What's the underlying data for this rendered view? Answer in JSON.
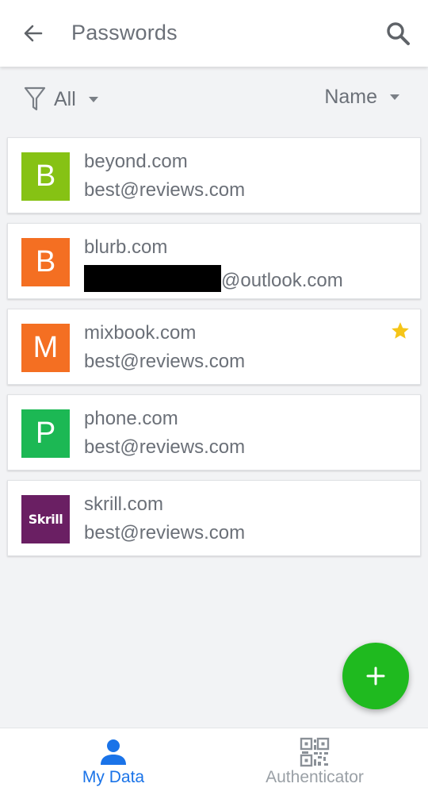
{
  "header": {
    "title": "Passwords"
  },
  "filter": {
    "label": "All"
  },
  "sort": {
    "label": "Name"
  },
  "entries": [
    {
      "initial": "B",
      "site": "beyond.com",
      "username": "best@reviews.com",
      "color": "#86c214",
      "favorite": false
    },
    {
      "initial": "B",
      "site": "blurb.com",
      "username_suffix": "@outlook.com",
      "username_redacted": true,
      "color": "#f46f22",
      "favorite": false
    },
    {
      "initial": "M",
      "site": "mixbook.com",
      "username": "best@reviews.com",
      "color": "#f46f22",
      "favorite": true
    },
    {
      "initial": "P",
      "site": "phone.com",
      "username": "best@reviews.com",
      "color": "#1cb854",
      "favorite": false
    },
    {
      "initial": "Skrill",
      "site": "skrill.com",
      "username": "best@reviews.com",
      "color": "#6a1f63",
      "favorite": false
    }
  ],
  "colors": {
    "accent": "#1a73e8",
    "fab": "#1fba1f",
    "star": "#f5c518"
  },
  "bottom_nav": {
    "items": [
      {
        "label": "My Data",
        "icon": "person-icon",
        "active": true
      },
      {
        "label": "Authenticator",
        "icon": "qr-code-icon",
        "active": false
      }
    ]
  }
}
